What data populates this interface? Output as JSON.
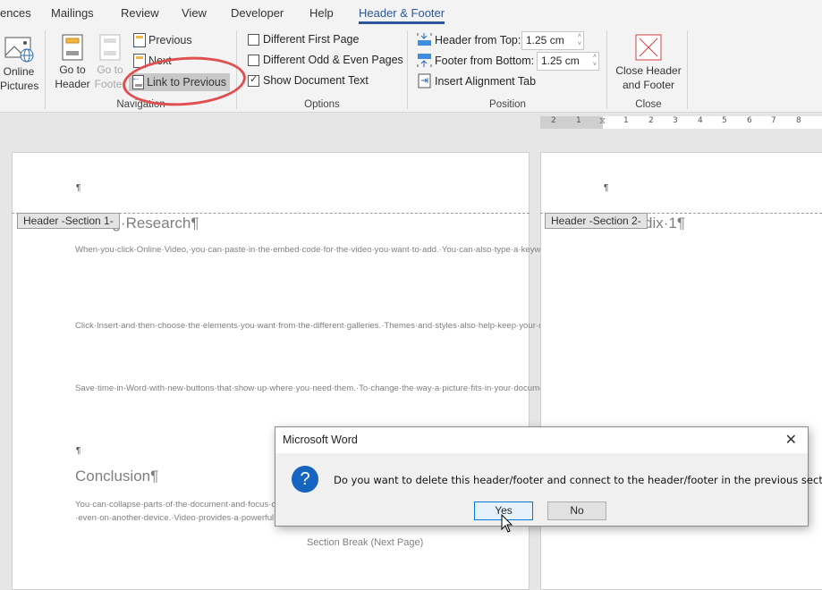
{
  "tabs": [
    {
      "label": "ences",
      "active": false
    },
    {
      "label": "Mailings",
      "active": false
    },
    {
      "label": "Review",
      "active": false
    },
    {
      "label": "View",
      "active": false
    },
    {
      "label": "Developer",
      "active": false
    },
    {
      "label": "Help",
      "active": false
    },
    {
      "label": "Header & Footer",
      "active": true
    }
  ],
  "ribbon": {
    "insert": {
      "online_pictures": "Online\nPictures"
    },
    "navigation": {
      "label": "Navigation",
      "go_to_header": "Go to\nHeader",
      "go_to_footer": "Go to\nFooter",
      "previous": "Previous",
      "next": "Next",
      "link_to_previous": "Link to Previous"
    },
    "options": {
      "label": "Options",
      "items": [
        {
          "label": "Different First Page",
          "checked": false
        },
        {
          "label": "Different Odd & Even Pages",
          "checked": false
        },
        {
          "label": "Show Document Text",
          "checked": true
        }
      ]
    },
    "position": {
      "label": "Position",
      "header_from_top_label": "Header from Top:",
      "header_from_top_value": "1.25 cm",
      "footer_from_bottom_label": "Footer from Bottom:",
      "footer_from_bottom_value": "1.25 cm",
      "insert_alignment_tab": "Insert Alignment Tab"
    },
    "close": {
      "label": "Close",
      "close_header_footer": "Close Header\nand Footer"
    }
  },
  "ruler": {
    "ticks": [
      "2",
      "1",
      "1",
      "2",
      "3",
      "4",
      "5",
      "6",
      "7",
      "8"
    ]
  },
  "page1": {
    "header_pilcrow": "¶",
    "header_tag": "Header -Section 1-",
    "heading": "ng·Research¶",
    "paragraphs": [
      "When·you·click·Online·Video,·you·can·paste·in·the·embed·code·for·the·video·you·want·to·add.·You·can·also·type·a·keyword·to·search·online·for·the·video·that·best·fits·your·document.·To·make·your·document·look·professionally·produced,·Word·provides·header,·footer,·cover·page,·and·text·box·designs·that·complement·each·other.·For·example,·you·can·add·a·matching·cover·page,·header,·and·sidebar.¶",
      "Click·Insert·and·then·choose·the·elements·you·want·from·the·different·galleries.·Themes·and·styles·also·help·keep·your·document·coordinated.·When·you·click·Design·and·choose·a·new·Theme,·the·pictures,·charts,·and·SmartArt·graphics·change·to·match·your·new·theme.·When·you·apply·styles,·your·headings·change·to·match·the·new·theme.¶",
      "Save·time·in·Word·with·new·buttons·that·show·up·where·you·need·them.·To·change·the·way·a·picture·fits·in·your·document,·click·it·and·a·button·for·layout·options·appears·next·to·it.·When·you·work·on·a·table,·click·where·you·want·to·add·a·row·or·a·column,·and·then·click·the·plus·sign.·Reading·is·easier,·too,·in·the·new·Reading·view.¶"
    ],
    "empty_pilcrow": "¶",
    "conclusion_heading": "Conclusion¶",
    "conclusion_para": "You·can·collapse·parts·of·the·document·and·focus·on·the·text·you·want.·If·you·need·to·stop·reading·before·you·reach·the·end,·Word·remembers·where·you·left·off·–·even·on·another·device.·Video·provides·a·powerful·way·to·help·you·prove·your·point.·When·you·click·Online·Video,·you·can·paste·in·the·embed·code·for·the·video·you·want·to·add.¶",
    "section_break": "Section Break (Next Page)"
  },
  "page2": {
    "header_pilcrow": "¶",
    "header_tag": "Header -Section 2-",
    "heading": "dix·1¶"
  },
  "dialog": {
    "title": "Microsoft Word",
    "message": "Do you want to delete this header/footer and connect to the header/footer in the previous section?",
    "yes": "Yes",
    "no": "No"
  }
}
